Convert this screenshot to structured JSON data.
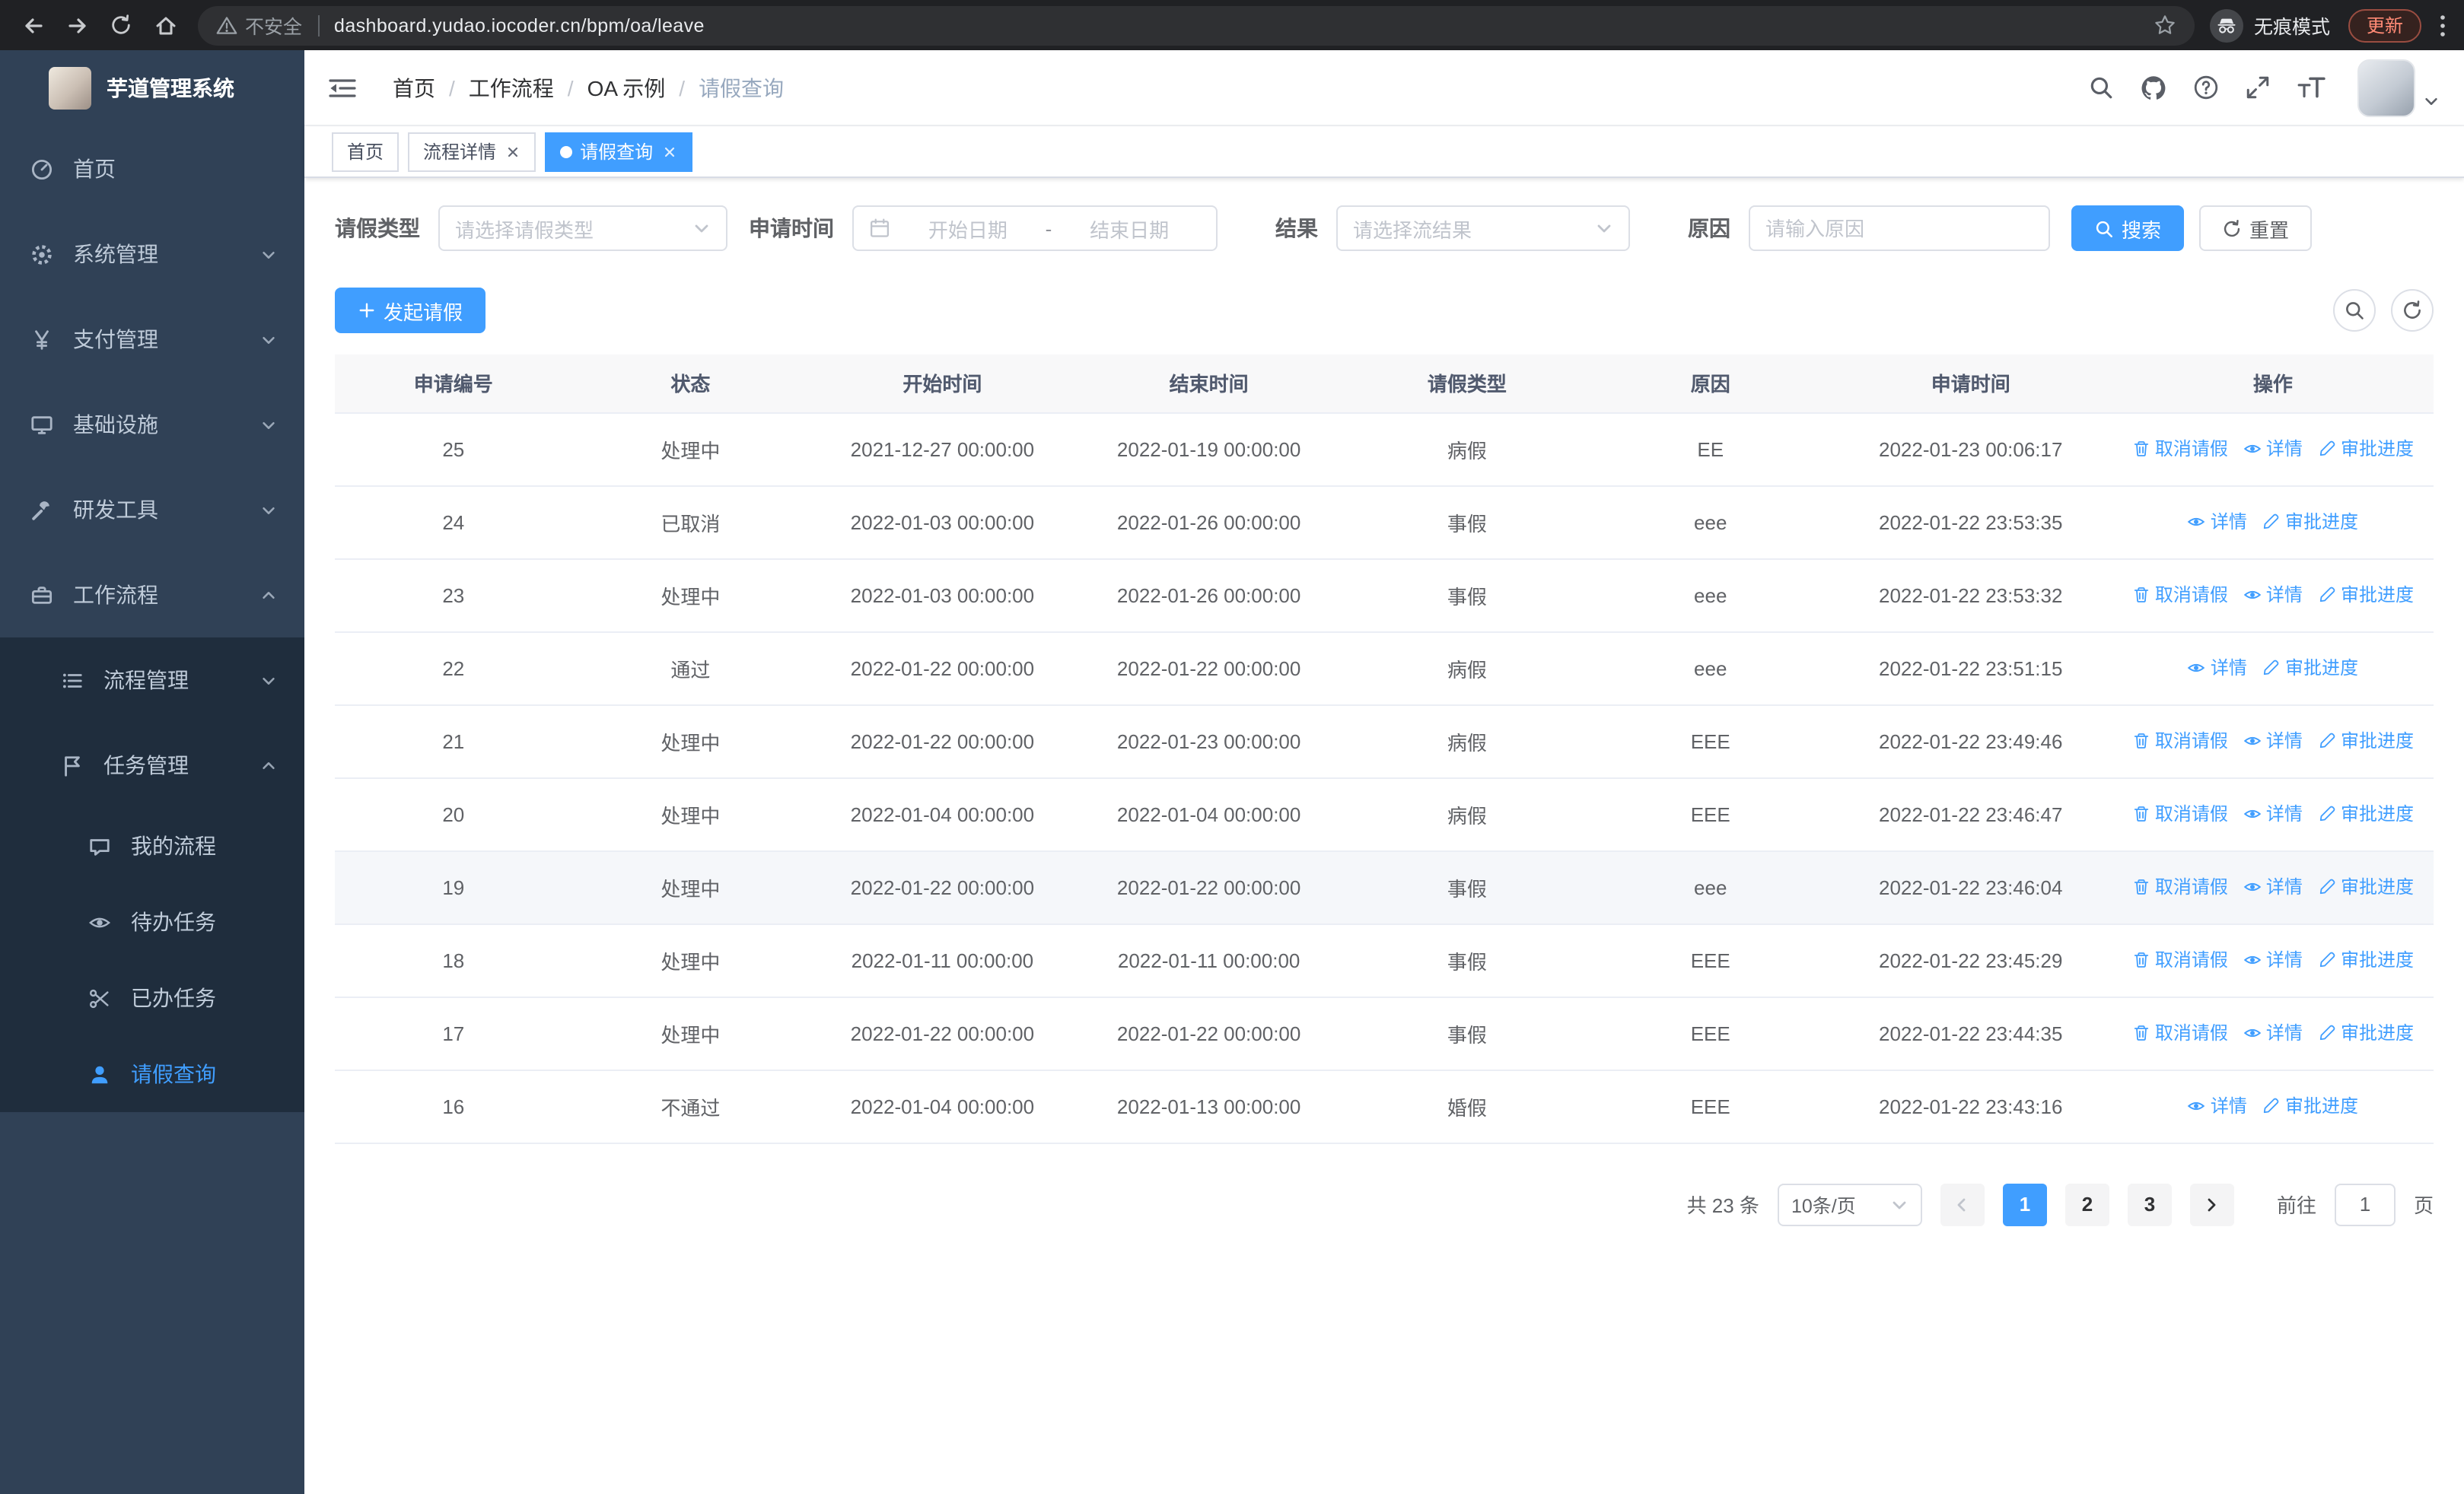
{
  "browser": {
    "security_label": "不安全",
    "url": "dashboard.yudao.iocoder.cn/bpm/oa/leave",
    "incognito_label": "无痕模式",
    "update_label": "更新"
  },
  "sidebar": {
    "app_title": "芋道管理系统",
    "menu": [
      {
        "label": "首页"
      },
      {
        "label": "系统管理"
      },
      {
        "label": "支付管理"
      },
      {
        "label": "基础设施"
      },
      {
        "label": "研发工具"
      },
      {
        "label": "工作流程"
      }
    ],
    "workflow_children": [
      {
        "label": "流程管理"
      },
      {
        "label": "任务管理"
      }
    ],
    "task_children": [
      {
        "label": "我的流程"
      },
      {
        "label": "待办任务"
      },
      {
        "label": "已办任务"
      },
      {
        "label": "请假查询",
        "active": true
      }
    ]
  },
  "navbar": {
    "breadcrumb": [
      "首页",
      "工作流程",
      "OA 示例",
      "请假查询"
    ],
    "separator": "/"
  },
  "tags": [
    {
      "label": "首页",
      "closable": false,
      "active": false
    },
    {
      "label": "流程详情",
      "closable": true,
      "active": false
    },
    {
      "label": "请假查询",
      "closable": true,
      "active": true
    }
  ],
  "filters": {
    "leave_type_label": "请假类型",
    "leave_type_placeholder": "请选择请假类型",
    "apply_time_label": "申请时间",
    "start_date_placeholder": "开始日期",
    "range_separator": "-",
    "end_date_placeholder": "结束日期",
    "result_label": "结果",
    "result_placeholder": "请选择流结果",
    "reason_label": "原因",
    "reason_placeholder": "请输入原因",
    "search_button": "搜索",
    "reset_button": "重置"
  },
  "toolbar": {
    "create_button": "发起请假"
  },
  "table": {
    "headers": [
      "申请编号",
      "状态",
      "开始时间",
      "结束时间",
      "请假类型",
      "原因",
      "申请时间",
      "操作"
    ],
    "action_labels": {
      "cancel": "取消请假",
      "detail": "详情",
      "progress": "审批进度"
    },
    "rows": [
      {
        "id": "25",
        "status": "处理中",
        "start": "2021-12-27 00:00:00",
        "end": "2022-01-19 00:00:00",
        "type": "病假",
        "reason": "EE",
        "apply": "2022-01-23 00:06:17",
        "cancelable": true,
        "highlighted": false
      },
      {
        "id": "24",
        "status": "已取消",
        "start": "2022-01-03 00:00:00",
        "end": "2022-01-26 00:00:00",
        "type": "事假",
        "reason": "eee",
        "apply": "2022-01-22 23:53:35",
        "cancelable": false,
        "highlighted": false
      },
      {
        "id": "23",
        "status": "处理中",
        "start": "2022-01-03 00:00:00",
        "end": "2022-01-26 00:00:00",
        "type": "事假",
        "reason": "eee",
        "apply": "2022-01-22 23:53:32",
        "cancelable": true,
        "highlighted": false
      },
      {
        "id": "22",
        "status": "通过",
        "start": "2022-01-22 00:00:00",
        "end": "2022-01-22 00:00:00",
        "type": "病假",
        "reason": "eee",
        "apply": "2022-01-22 23:51:15",
        "cancelable": false,
        "highlighted": false
      },
      {
        "id": "21",
        "status": "处理中",
        "start": "2022-01-22 00:00:00",
        "end": "2022-01-23 00:00:00",
        "type": "病假",
        "reason": "EEE",
        "apply": "2022-01-22 23:49:46",
        "cancelable": true,
        "highlighted": false
      },
      {
        "id": "20",
        "status": "处理中",
        "start": "2022-01-04 00:00:00",
        "end": "2022-01-04 00:00:00",
        "type": "病假",
        "reason": "EEE",
        "apply": "2022-01-22 23:46:47",
        "cancelable": true,
        "highlighted": false
      },
      {
        "id": "19",
        "status": "处理中",
        "start": "2022-01-22 00:00:00",
        "end": "2022-01-22 00:00:00",
        "type": "事假",
        "reason": "eee",
        "apply": "2022-01-22 23:46:04",
        "cancelable": true,
        "highlighted": true
      },
      {
        "id": "18",
        "status": "处理中",
        "start": "2022-01-11 00:00:00",
        "end": "2022-01-11 00:00:00",
        "type": "事假",
        "reason": "EEE",
        "apply": "2022-01-22 23:45:29",
        "cancelable": true,
        "highlighted": false
      },
      {
        "id": "17",
        "status": "处理中",
        "start": "2022-01-22 00:00:00",
        "end": "2022-01-22 00:00:00",
        "type": "事假",
        "reason": "EEE",
        "apply": "2022-01-22 23:44:35",
        "cancelable": true,
        "highlighted": false
      },
      {
        "id": "16",
        "status": "不通过",
        "start": "2022-01-04 00:00:00",
        "end": "2022-01-13 00:00:00",
        "type": "婚假",
        "reason": "EEE",
        "apply": "2022-01-22 23:43:16",
        "cancelable": false,
        "highlighted": false
      }
    ]
  },
  "pagination": {
    "total_label": "共 23 条",
    "page_size": "10条/页",
    "pages": [
      "1",
      "2",
      "3"
    ],
    "active_page": "1",
    "goto_label": "前往",
    "goto_value": "1",
    "unit_label": "页"
  },
  "colors": {
    "primary": "#409EFF",
    "sidebar_bg": "#304156",
    "sidebar_submenu_bg": "#1F2D3D",
    "table_header_bg": "#F8F8F9",
    "row_hover_bg": "#F5F7FA",
    "update_badge_text": "#FF8A75"
  }
}
